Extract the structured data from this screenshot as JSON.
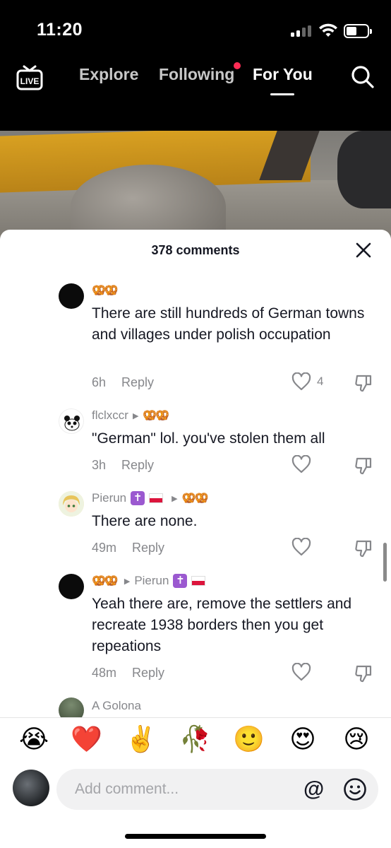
{
  "status_bar": {
    "time": "11:20"
  },
  "top_nav": {
    "live_label": "LIVE",
    "tabs": [
      {
        "label": "Explore",
        "active": false
      },
      {
        "label": "Following",
        "active": false,
        "notification_dot": true
      },
      {
        "label": "For You",
        "active": true
      }
    ]
  },
  "comments_sheet": {
    "title": "378 comments",
    "comments": [
      {
        "username": "🥨🥨",
        "text": "There are still hundreds of German towns and villages under polish occupation",
        "time": "6h",
        "reply_label": "Reply",
        "likes": "4"
      },
      {
        "username": "flclxccr",
        "reply_to": "🥨🥨",
        "text": "\"German\" lol. you've stolen them all",
        "time": "3h",
        "reply_label": "Reply",
        "likes": ""
      },
      {
        "username": "Pierun",
        "username_badges": [
          "✝️",
          "🇵🇱"
        ],
        "reply_to": "🥨🥨",
        "text": "There are none.",
        "time": "49m",
        "reply_label": "Reply",
        "likes": ""
      },
      {
        "username": "🥨🥨",
        "reply_to": "Pierun",
        "reply_to_badges": [
          "✝️",
          "🇵🇱"
        ],
        "text": "Yeah there are, remove the settlers and recreate 1938 borders then you get repeations",
        "time": "48m",
        "reply_label": "Reply",
        "likes": ""
      },
      {
        "username": "A Golona"
      }
    ]
  },
  "emoji_bar": [
    "😭",
    "❤️",
    "✌️",
    "🥀",
    "🙂",
    "😍",
    "😢"
  ],
  "comment_input": {
    "placeholder": "Add comment..."
  }
}
